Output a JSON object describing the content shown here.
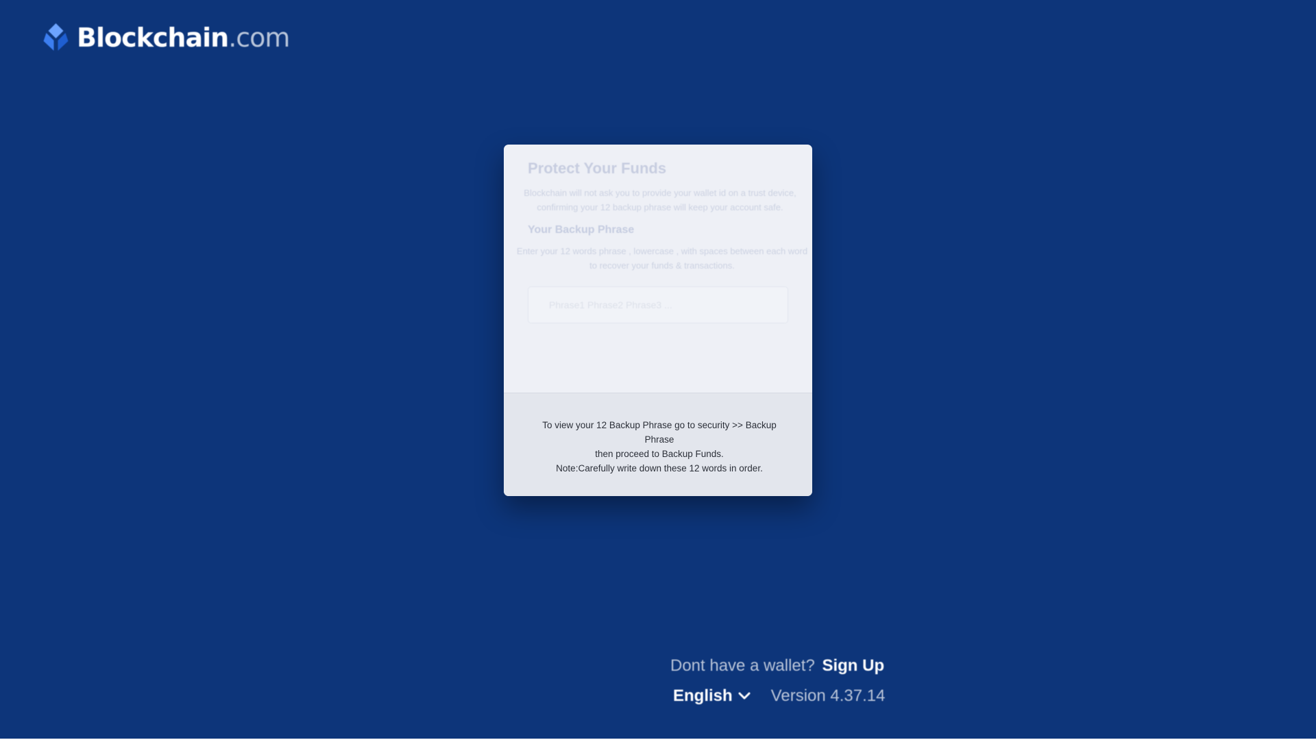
{
  "brand": {
    "name": "Blockchain",
    "suffix": ".com",
    "icon": "blockchain-logo-icon",
    "colors": {
      "icon_light": "#6da4ff",
      "icon_mid": "#3c7ef0",
      "icon_dark": "#1f5fd1",
      "background": "#0d357a"
    }
  },
  "card": {
    "title": "Protect Your Funds",
    "description": "Blockchain will not ask you to provide your wallet id on a trust device, confirming your 12 backup phrase will keep your account safe.",
    "subtitle": "Your Backup Phrase",
    "subdescription": "Enter your 12 words phrase , lowercase , with spaces between each word to recover your funds & transactions.",
    "input": {
      "placeholder": "Phrase1 Phrase2 Phrase3 ...",
      "value": ""
    },
    "footer": {
      "line1": "To view your 12 Backup Phrase go to security >> Backup Phrase",
      "line2": "then proceed to Backup Funds.",
      "line3": "Note:Carefully write down these 12 words in order."
    }
  },
  "bottom": {
    "signup_prompt": "Dont have a wallet?",
    "signup_link": "Sign Up",
    "language": "English",
    "language_icon": "chevron-down-icon",
    "version": "Version 4.37.14"
  }
}
